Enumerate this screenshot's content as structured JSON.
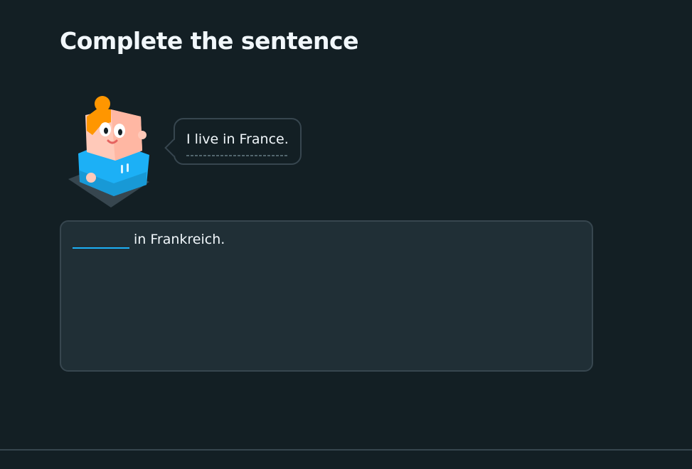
{
  "exercise": {
    "title": "Complete the sentence",
    "prompt": "I live in France.",
    "blank_value": "",
    "sentence_rest": "in Frankreich."
  },
  "character": {
    "icon": "character-icon",
    "colors": {
      "hair": "#ff9600",
      "skin": "#ffc9b9",
      "shirt": "#1cb0f6",
      "shadow": "#37464f"
    }
  },
  "theme": {
    "background": "#131f24",
    "panel": "#202f36",
    "border": "#37464f",
    "accent": "#1cb0f6",
    "text": "#f1f7fb"
  }
}
